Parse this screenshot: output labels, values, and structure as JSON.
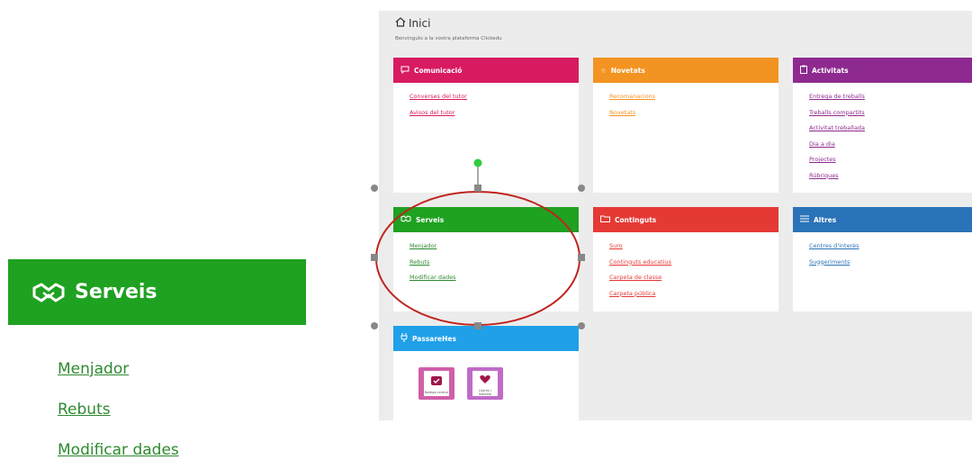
{
  "zoom": {
    "title": "Serveis",
    "color": "#1fa121",
    "link_color": "#2e8a2f",
    "links": [
      "Menjador",
      "Rebuts",
      "Modificar dades"
    ]
  },
  "screenshot": {
    "page_title": "Inici",
    "page_subtitle": "Benvinguts a la vostra plataforma Clickedu",
    "cards": [
      {
        "title": "Comunicació",
        "color": "#d81b60",
        "icon": "chat-icon",
        "links": [
          "Converses del tutor",
          "Avisos del tutor"
        ]
      },
      {
        "title": "Novetats",
        "color": "#f39321",
        "icon": "star-icon",
        "links": [
          "Recomanacions",
          "Novetats"
        ]
      },
      {
        "title": "Activitats",
        "color": "#8e2a8f",
        "icon": "clipboard-icon",
        "links": [
          "Entrega de treballs",
          "Treballs compartits",
          "Activitat treballada",
          "Dia a dia",
          "Projectes",
          "Rúbriques"
        ]
      },
      {
        "title": "Serveis",
        "color": "#1fa121",
        "icon": "handshake-icon",
        "links": [
          "Menjador",
          "Rebuts",
          "Modificar dades"
        ]
      },
      {
        "title": "Continguts",
        "color": "#e53935",
        "icon": "folder-icon",
        "links": [
          "Suro",
          "Continguts educatius",
          "Carpeta de classe",
          "Carpeta pública"
        ]
      },
      {
        "title": "Altres",
        "color": "#2b73b8",
        "icon": "list-icon",
        "links": [
          "Centres d'interès",
          "Suggeriments"
        ]
      },
      {
        "title": "PassareHes",
        "color": "#1fa0e8",
        "icon": "plug-icon",
        "links": []
      }
    ],
    "app_tiles": [
      {
        "label": "Bottiga central",
        "color": "#d05fa8"
      },
      {
        "label": "Llibres i material",
        "color": "#c06bc7"
      }
    ]
  }
}
